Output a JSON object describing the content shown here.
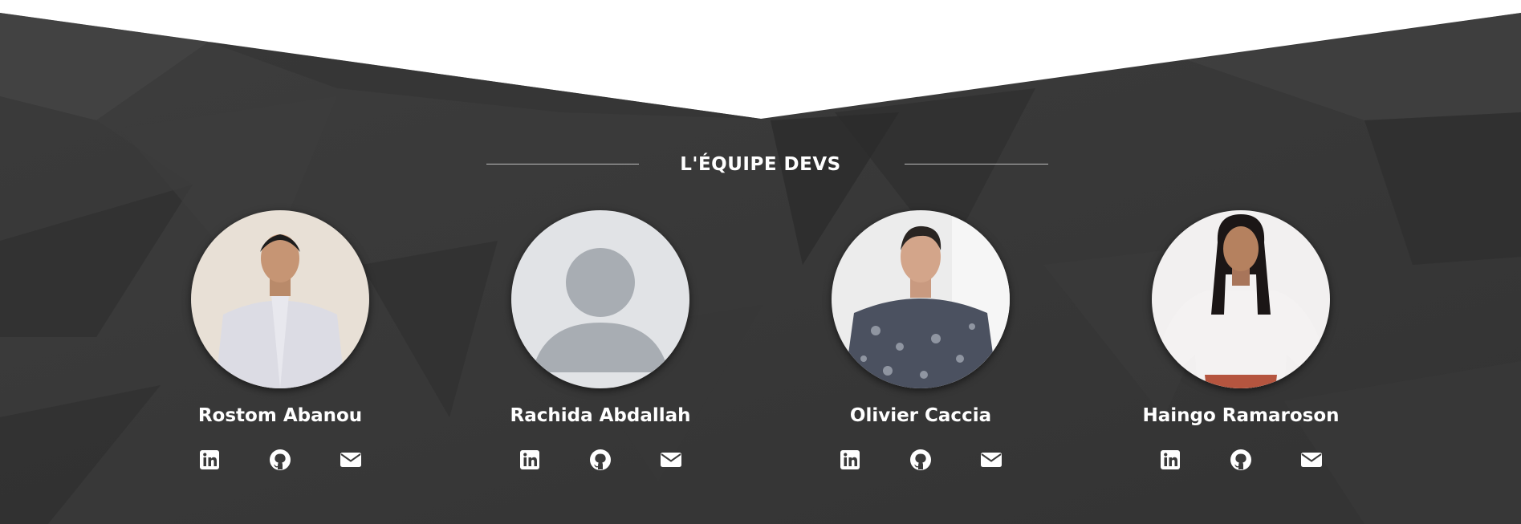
{
  "section": {
    "title": "L'ÉQUIPE DEVS"
  },
  "colors": {
    "background": "#3a3a3a",
    "text": "#ffffff",
    "divider": "#bdbdbd"
  },
  "members": [
    {
      "name": "Rostom Abanou",
      "photo": "photo-man-white-shirt",
      "links": [
        "linkedin-icon",
        "github-icon",
        "envelope-icon"
      ]
    },
    {
      "name": "Rachida Abdallah",
      "photo": "default-avatar-placeholder",
      "links": [
        "linkedin-icon",
        "github-icon",
        "envelope-icon"
      ]
    },
    {
      "name": "Olivier Caccia",
      "photo": "photo-man-patterned-shirt",
      "links": [
        "linkedin-icon",
        "github-icon",
        "envelope-icon"
      ]
    },
    {
      "name": "Haingo Ramaroson",
      "photo": "photo-woman-white-blouse",
      "links": [
        "linkedin-icon",
        "github-icon",
        "envelope-icon"
      ]
    }
  ]
}
